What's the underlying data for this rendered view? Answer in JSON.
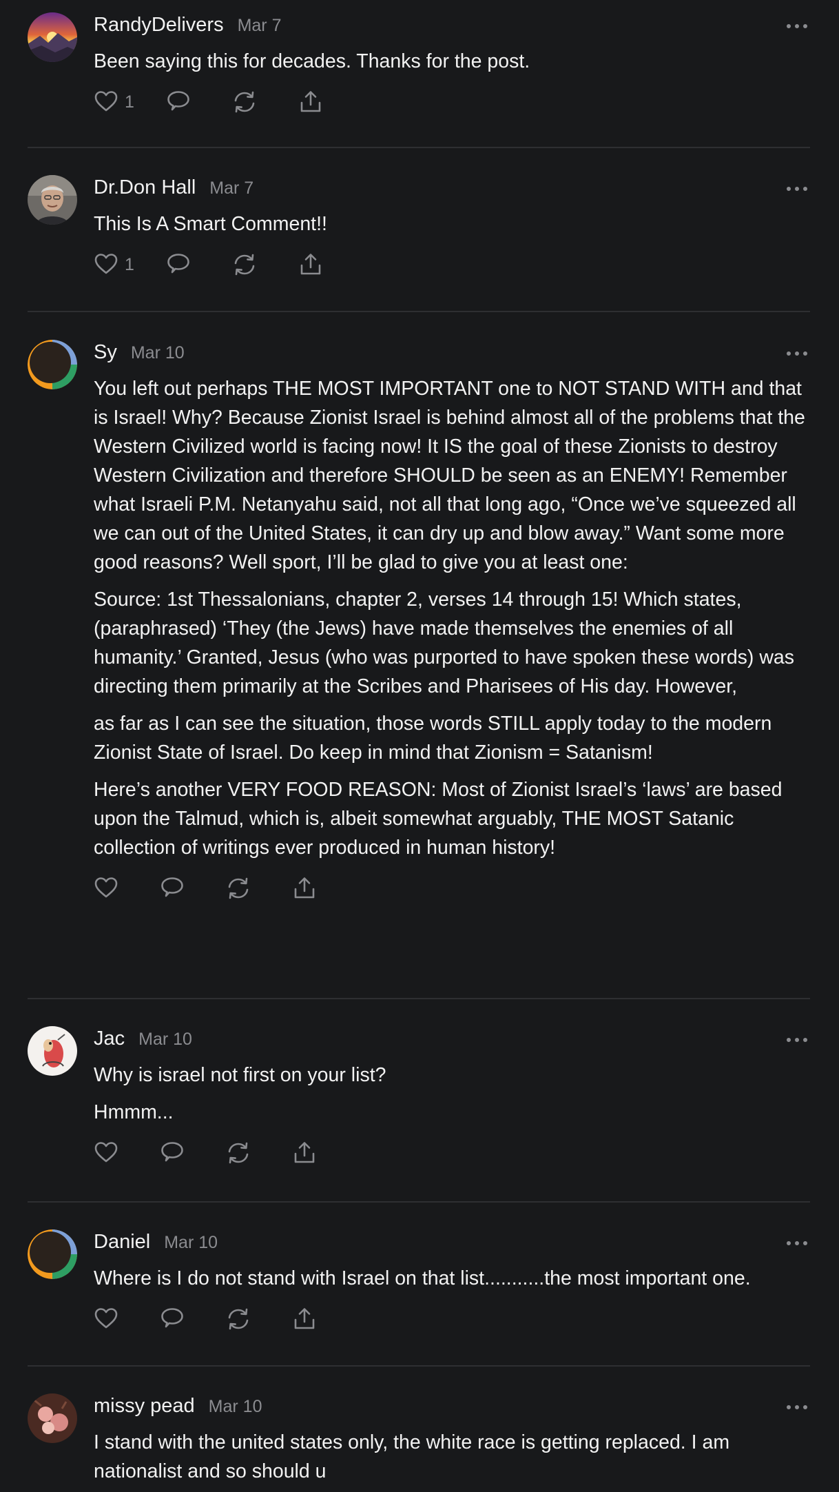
{
  "comments": [
    {
      "author": "RandyDelivers",
      "date": "Mar 7",
      "paragraphs": [
        "Been saying this for decades. Thanks for the post."
      ],
      "likes": "1"
    },
    {
      "author": "Dr.Don Hall",
      "date": "Mar 7",
      "paragraphs": [
        "This Is A Smart Comment!!"
      ],
      "likes": "1"
    },
    {
      "author": "Sy",
      "date": "Mar 10",
      "paragraphs": [
        "You left out perhaps THE MOST IMPORTANT one to NOT STAND WITH and that is Israel! Why? Because Zionist Israel is behind almost all of the problems that the Western Civilized world is facing now! It IS the goal of these Zionists to destroy Western Civilization and therefore SHOULD be seen as an ENEMY! Remember what Israeli P.M. Netanyahu said, not all that long ago, “Once we’ve squeezed all we can out of the United States, it can dry up and blow away.” Want some more good reasons? Well sport, I’ll be glad to give you at least one:",
        "Source: 1st Thessalonians, chapter 2, verses 14 through 15! Which states, (paraphrased) ‘They (the Jews) have made themselves the enemies of all humanity.’ Granted, Jesus (who was purported to have spoken these words) was directing them primarily at the Scribes and Pharisees of His day. However,",
        "as far as I can see the situation, those words STILL apply today to the modern Zionist State of Israel. Do keep in mind that Zionism = Satanism!",
        "Here’s another VERY FOOD REASON: Most of Zionist Israel’s ‘laws’ are based upon the Talmud, which is, albeit somewhat arguably, THE MOST Satanic collection of writings ever produced in human history!"
      ],
      "likes": ""
    },
    {
      "author": "Jac",
      "date": "Mar 10",
      "paragraphs": [
        "Why is israel not first on your list?",
        "Hmmm..."
      ],
      "likes": ""
    },
    {
      "author": "Daniel",
      "date": "Mar 10",
      "paragraphs": [
        "Where is I do not stand with Israel on that list...........the most important one."
      ],
      "likes": ""
    },
    {
      "author": "missy pead",
      "date": "Mar 10",
      "paragraphs": [
        "I stand with the united states only, the white race is getting replaced. I am nationalist and so should u"
      ],
      "likes": ""
    }
  ],
  "icons": {
    "like": "heart-icon",
    "reply": "speech-bubble-icon",
    "restack": "restack-icon",
    "share": "share-icon",
    "more": "more-dots-icon"
  },
  "colors": {
    "background": "#18191b",
    "text": "#f2f2f2",
    "muted": "#8b8c90",
    "divider": "#2e2f32"
  }
}
